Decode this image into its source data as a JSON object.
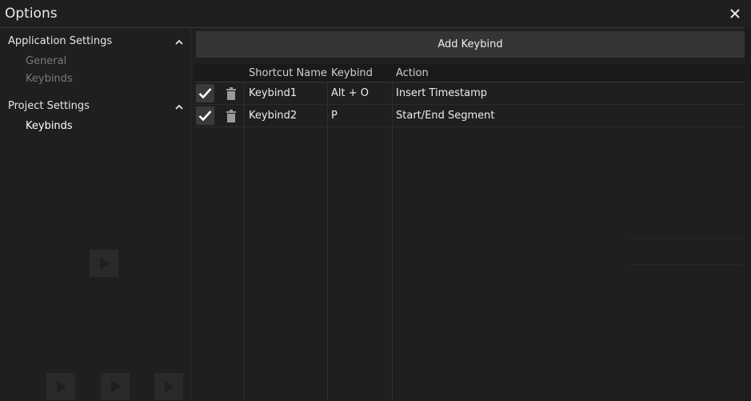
{
  "window": {
    "title": "Options"
  },
  "sidebar": {
    "sections": [
      {
        "label": "Application Settings",
        "items": [
          "General",
          "Keybinds"
        ]
      },
      {
        "label": "Project Settings",
        "items": [
          "Keybinds"
        ]
      }
    ]
  },
  "toolbar": {
    "add_label": "Add Keybind"
  },
  "table": {
    "columns": [
      "Shortcut Name",
      "Keybind",
      "Action"
    ],
    "rows": [
      {
        "enabled": true,
        "name": "Keybind1",
        "keybind": "Alt + O",
        "action": "Insert Timestamp"
      },
      {
        "enabled": true,
        "name": "Keybind2",
        "keybind": "P",
        "action": "Start/End Segment"
      }
    ]
  },
  "icons": {
    "close": "close-icon",
    "expand": "chevron-up-icon",
    "check": "check-icon",
    "delete": "trash-icon"
  },
  "colors": {
    "background": "#1f1f1f",
    "button": "#343434",
    "text": "#e6e6e6",
    "muted": "#7a7a7a"
  }
}
